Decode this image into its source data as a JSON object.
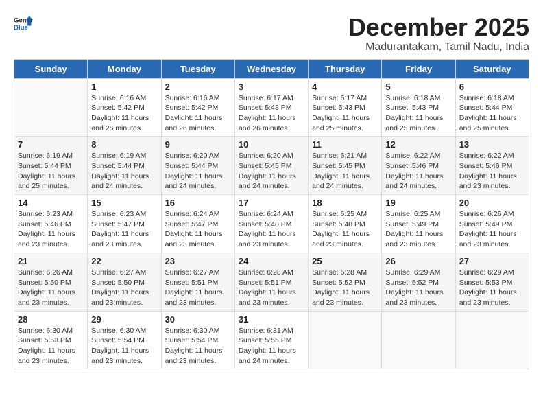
{
  "logo": {
    "text_general": "General",
    "text_blue": "Blue"
  },
  "header": {
    "month": "December 2025",
    "location": "Madurantakam, Tamil Nadu, India"
  },
  "days_of_week": [
    "Sunday",
    "Monday",
    "Tuesday",
    "Wednesday",
    "Thursday",
    "Friday",
    "Saturday"
  ],
  "weeks": [
    [
      {
        "day": "",
        "info": ""
      },
      {
        "day": "1",
        "info": "Sunrise: 6:16 AM\nSunset: 5:42 PM\nDaylight: 11 hours\nand 26 minutes."
      },
      {
        "day": "2",
        "info": "Sunrise: 6:16 AM\nSunset: 5:42 PM\nDaylight: 11 hours\nand 26 minutes."
      },
      {
        "day": "3",
        "info": "Sunrise: 6:17 AM\nSunset: 5:43 PM\nDaylight: 11 hours\nand 26 minutes."
      },
      {
        "day": "4",
        "info": "Sunrise: 6:17 AM\nSunset: 5:43 PM\nDaylight: 11 hours\nand 25 minutes."
      },
      {
        "day": "5",
        "info": "Sunrise: 6:18 AM\nSunset: 5:43 PM\nDaylight: 11 hours\nand 25 minutes."
      },
      {
        "day": "6",
        "info": "Sunrise: 6:18 AM\nSunset: 5:44 PM\nDaylight: 11 hours\nand 25 minutes."
      }
    ],
    [
      {
        "day": "7",
        "info": "Sunrise: 6:19 AM\nSunset: 5:44 PM\nDaylight: 11 hours\nand 25 minutes."
      },
      {
        "day": "8",
        "info": "Sunrise: 6:19 AM\nSunset: 5:44 PM\nDaylight: 11 hours\nand 24 minutes."
      },
      {
        "day": "9",
        "info": "Sunrise: 6:20 AM\nSunset: 5:44 PM\nDaylight: 11 hours\nand 24 minutes."
      },
      {
        "day": "10",
        "info": "Sunrise: 6:20 AM\nSunset: 5:45 PM\nDaylight: 11 hours\nand 24 minutes."
      },
      {
        "day": "11",
        "info": "Sunrise: 6:21 AM\nSunset: 5:45 PM\nDaylight: 11 hours\nand 24 minutes."
      },
      {
        "day": "12",
        "info": "Sunrise: 6:22 AM\nSunset: 5:46 PM\nDaylight: 11 hours\nand 24 minutes."
      },
      {
        "day": "13",
        "info": "Sunrise: 6:22 AM\nSunset: 5:46 PM\nDaylight: 11 hours\nand 23 minutes."
      }
    ],
    [
      {
        "day": "14",
        "info": "Sunrise: 6:23 AM\nSunset: 5:46 PM\nDaylight: 11 hours\nand 23 minutes."
      },
      {
        "day": "15",
        "info": "Sunrise: 6:23 AM\nSunset: 5:47 PM\nDaylight: 11 hours\nand 23 minutes."
      },
      {
        "day": "16",
        "info": "Sunrise: 6:24 AM\nSunset: 5:47 PM\nDaylight: 11 hours\nand 23 minutes."
      },
      {
        "day": "17",
        "info": "Sunrise: 6:24 AM\nSunset: 5:48 PM\nDaylight: 11 hours\nand 23 minutes."
      },
      {
        "day": "18",
        "info": "Sunrise: 6:25 AM\nSunset: 5:48 PM\nDaylight: 11 hours\nand 23 minutes."
      },
      {
        "day": "19",
        "info": "Sunrise: 6:25 AM\nSunset: 5:49 PM\nDaylight: 11 hours\nand 23 minutes."
      },
      {
        "day": "20",
        "info": "Sunrise: 6:26 AM\nSunset: 5:49 PM\nDaylight: 11 hours\nand 23 minutes."
      }
    ],
    [
      {
        "day": "21",
        "info": "Sunrise: 6:26 AM\nSunset: 5:50 PM\nDaylight: 11 hours\nand 23 minutes."
      },
      {
        "day": "22",
        "info": "Sunrise: 6:27 AM\nSunset: 5:50 PM\nDaylight: 11 hours\nand 23 minutes."
      },
      {
        "day": "23",
        "info": "Sunrise: 6:27 AM\nSunset: 5:51 PM\nDaylight: 11 hours\nand 23 minutes."
      },
      {
        "day": "24",
        "info": "Sunrise: 6:28 AM\nSunset: 5:51 PM\nDaylight: 11 hours\nand 23 minutes."
      },
      {
        "day": "25",
        "info": "Sunrise: 6:28 AM\nSunset: 5:52 PM\nDaylight: 11 hours\nand 23 minutes."
      },
      {
        "day": "26",
        "info": "Sunrise: 6:29 AM\nSunset: 5:52 PM\nDaylight: 11 hours\nand 23 minutes."
      },
      {
        "day": "27",
        "info": "Sunrise: 6:29 AM\nSunset: 5:53 PM\nDaylight: 11 hours\nand 23 minutes."
      }
    ],
    [
      {
        "day": "28",
        "info": "Sunrise: 6:30 AM\nSunset: 5:53 PM\nDaylight: 11 hours\nand 23 minutes."
      },
      {
        "day": "29",
        "info": "Sunrise: 6:30 AM\nSunset: 5:54 PM\nDaylight: 11 hours\nand 23 minutes."
      },
      {
        "day": "30",
        "info": "Sunrise: 6:30 AM\nSunset: 5:54 PM\nDaylight: 11 hours\nand 23 minutes."
      },
      {
        "day": "31",
        "info": "Sunrise: 6:31 AM\nSunset: 5:55 PM\nDaylight: 11 hours\nand 24 minutes."
      },
      {
        "day": "",
        "info": ""
      },
      {
        "day": "",
        "info": ""
      },
      {
        "day": "",
        "info": ""
      }
    ]
  ]
}
